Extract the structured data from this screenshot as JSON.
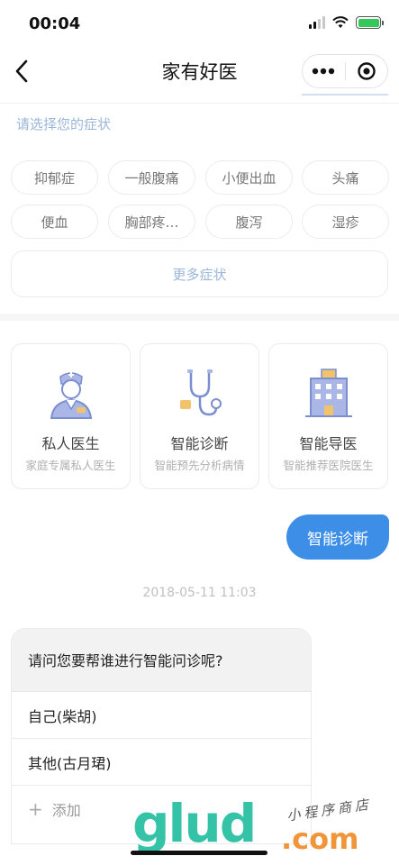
{
  "status_bar": {
    "time": "00:04"
  },
  "nav": {
    "title": "家有好医"
  },
  "hint": "请选择您的症状",
  "symptoms": [
    "抑郁症",
    "一般腹痛",
    "小便出血",
    "头痛",
    "便血",
    "胸部疼…",
    "腹泻",
    "湿疹"
  ],
  "more_symptoms": "更多症状",
  "features": [
    {
      "title": "私人医生",
      "subtitle": "家庭专属私人医生",
      "icon": "doctor-icon"
    },
    {
      "title": "智能诊断",
      "subtitle": "智能预先分析病情",
      "icon": "stethoscope-icon"
    },
    {
      "title": "智能导医",
      "subtitle": "智能推荐医院医生",
      "icon": "hospital-icon"
    }
  ],
  "chat": {
    "user_message": "智能诊断",
    "timestamp": "2018-05-11 11:03",
    "question": "请问您要帮谁进行智能问诊呢?",
    "options": [
      "自己(柴胡)",
      "其他(古月珺)"
    ],
    "add_label": "添加"
  },
  "watermark": {
    "brand": "glud",
    "domain": ".com",
    "tagline": "小程序商店"
  },
  "colors": {
    "accent": "#3d8ee6",
    "hint": "#9ab6d8",
    "icon_blue": "#7b8fd0",
    "watermark_green": "#34c3a7",
    "watermark_orange": "#f0953a"
  }
}
